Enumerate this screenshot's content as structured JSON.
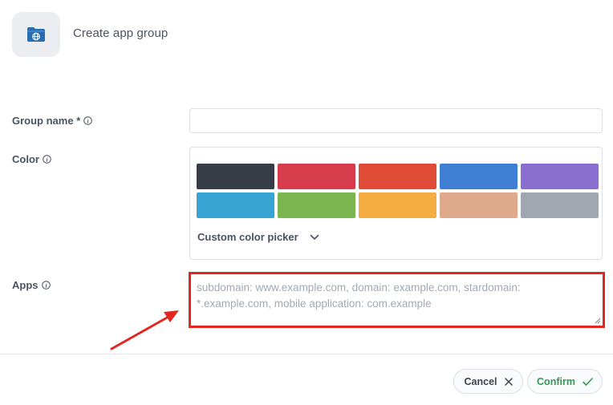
{
  "header": {
    "title": "Create app group",
    "icon": "folder-globe-icon"
  },
  "form": {
    "group_name": {
      "label": "Group name *",
      "value": "",
      "placeholder": ""
    },
    "color": {
      "label": "Color",
      "swatches": [
        "#373d46",
        "#d63c4b",
        "#e04b38",
        "#3e7fd4",
        "#8a6fd1",
        "#38a4d4",
        "#7bb550",
        "#f4ac43",
        "#dfaa8c",
        "#a1a7b0"
      ],
      "custom_picker_label": "Custom color picker"
    },
    "apps": {
      "label": "Apps",
      "value": "",
      "placeholder": "subdomain: www.example.com, domain: example.com, stardomain: *.example.com, mobile application: com.example"
    }
  },
  "footer": {
    "cancel_label": "Cancel",
    "confirm_label": "Confirm"
  },
  "colors": {
    "highlight": "#e3261f",
    "confirm": "#2f9a4f",
    "icon_blue": "#2a6cb0"
  }
}
